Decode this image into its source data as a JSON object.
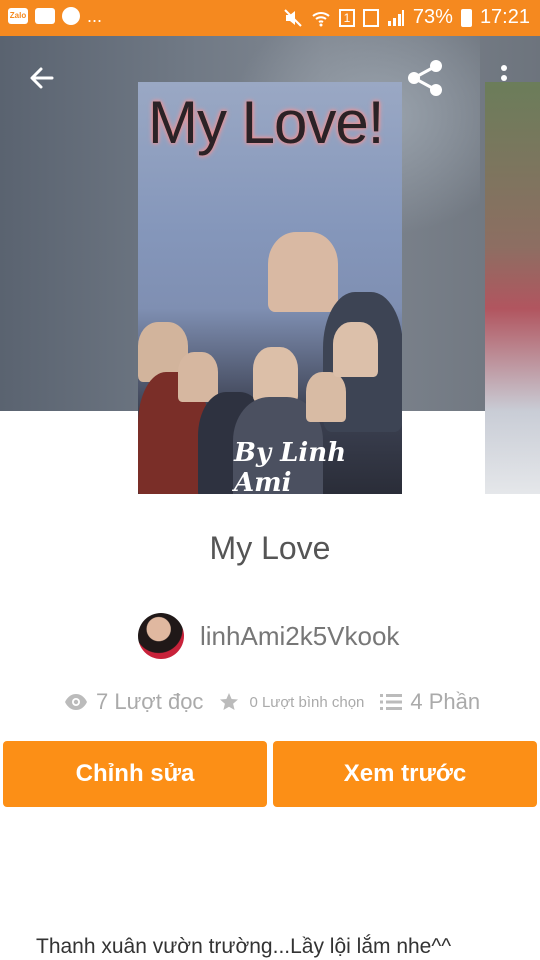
{
  "status_bar": {
    "notification_icons": [
      "zalo-icon",
      "message-icon",
      "messenger-icon"
    ],
    "more_indicator": "...",
    "battery_percent": "73%",
    "time": "17:21",
    "sim_badge": "1"
  },
  "header": {
    "back_icon": "arrow-left-icon",
    "share_icon": "share-icon",
    "more_icon": "more-vertical-icon"
  },
  "cover": {
    "title_text": "My Love!",
    "author_text": "By Linh Ami"
  },
  "story": {
    "title": "My Love",
    "author": "linhAmi2k5Vkook",
    "reads": "7 Lượt đọc",
    "votes": "0 Lượt bình chọn",
    "parts": "4 Phần",
    "description": "Thanh xuân vườn trường...Lầy lội lắm nhe^^"
  },
  "actions": {
    "edit_label": "Chỉnh sửa",
    "preview_label": "Xem trước"
  },
  "colors": {
    "accent": "#fc8f16",
    "status_bar": "#f5891f"
  }
}
